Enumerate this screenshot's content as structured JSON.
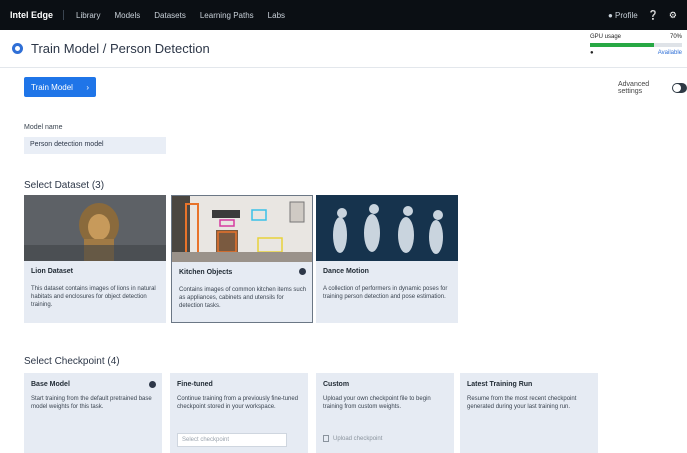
{
  "topbar": {
    "brand": "Intel Edge",
    "nav": [
      "Library",
      "Models",
      "Datasets",
      "Learning Paths",
      "Labs"
    ],
    "user": "Profile",
    "help_icon": "help-icon",
    "settings_icon": "gear-icon"
  },
  "page": {
    "title": "Train Model / Person Detection",
    "title_icon": "target-icon"
  },
  "gpu": {
    "label": "GPU usage",
    "value": "70%",
    "usage_fraction": 0.7,
    "status": "Available",
    "fill_color": "#27a844"
  },
  "toolbar": {
    "train_label": "Train Model",
    "toggle_label": "Advanced settings"
  },
  "model": {
    "label": "Model name",
    "value": "Person detection model"
  },
  "datasets": {
    "heading": "Select Dataset (3)",
    "items": [
      {
        "title": "Lion Dataset",
        "desc": "This dataset contains images of lions in natural habitats and enclosures for object detection training."
      },
      {
        "title": "Kitchen Objects",
        "desc": "Contains images of common kitchen items such as appliances, cabinets and utensils for detection tasks."
      },
      {
        "title": "Dance Motion",
        "desc": "A collection of performers in dynamic poses for training person detection and pose estimation."
      }
    ]
  },
  "checkpoints": {
    "heading": "Select Checkpoint (4)",
    "items": [
      {
        "title": "Base Model",
        "desc": "Start training from the default pretrained base model weights for this task.",
        "extra_type": "none"
      },
      {
        "title": "Fine-tuned",
        "desc": "Continue training from a previously fine-tuned checkpoint stored in your workspace.",
        "extra_type": "input",
        "extra": "Select checkpoint"
      },
      {
        "title": "Custom",
        "desc": "Upload your own checkpoint file to begin training from custom weights.",
        "extra_type": "upload",
        "extra": "Upload checkpoint"
      },
      {
        "title": "Latest Training Run",
        "desc": "Resume from the most recent checkpoint generated during your last training run.",
        "extra_type": "none"
      }
    ]
  }
}
